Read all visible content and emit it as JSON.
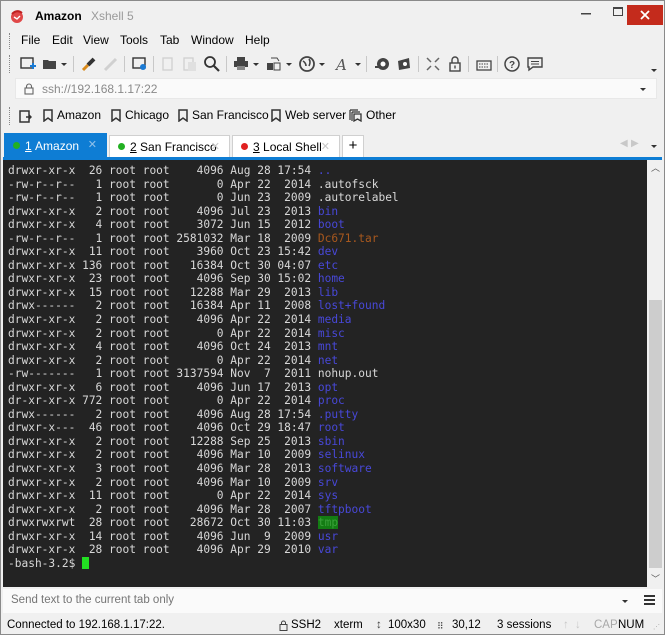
{
  "window": {
    "title": "Amazon",
    "app_name": "Xshell 5",
    "close_color": "#c42b1c"
  },
  "menu": [
    "File",
    "Edit",
    "View",
    "Tools",
    "Tab",
    "Window",
    "Help"
  ],
  "toolbar": {
    "icons": [
      "new-session-icon",
      "open-folder-icon",
      "connect-icon",
      "disconnect-icon",
      "session-properties-icon",
      "copy-icon",
      "paste-icon",
      "find-icon",
      "print-icon",
      "transfer-icon",
      "globe-icon",
      "font-icon",
      "xftp-icon",
      "xmanager-icon",
      "fullscreen-icon",
      "lock-icon",
      "keyboard-icon",
      "help-icon",
      "chat-icon"
    ]
  },
  "address": {
    "value": "ssh://192.168.1.17:22"
  },
  "links": [
    {
      "label": "Amazon"
    },
    {
      "label": "Chicago"
    },
    {
      "label": "San Francisco"
    },
    {
      "label": "Web server"
    },
    {
      "label": "Other"
    }
  ],
  "tabs": [
    {
      "num": "1",
      "label": "Amazon",
      "status_color": "#22b022",
      "active": true
    },
    {
      "num": "2",
      "label": "San Francisco",
      "status_color": "#22b022",
      "active": false
    },
    {
      "num": "3",
      "label": "Local Shell",
      "status_color": "#e02020",
      "active": false
    }
  ],
  "terminal": {
    "lines": [
      {
        "perm": "drwxr-xr-x",
        "links": "26",
        "owner": "root",
        "group": "root",
        "size": "4096",
        "date": "Aug 28 17:54",
        "name": "..",
        "type": "dir"
      },
      {
        "perm": "-rw-r--r--",
        "links": "1",
        "owner": "root",
        "group": "root",
        "size": "0",
        "date": "Apr 22  2014",
        "name": ".autofsck",
        "type": "file"
      },
      {
        "perm": "-rw-r--r--",
        "links": "1",
        "owner": "root",
        "group": "root",
        "size": "0",
        "date": "Jun 23  2009",
        "name": ".autorelabel",
        "type": "file"
      },
      {
        "perm": "drwxr-xr-x",
        "links": "2",
        "owner": "root",
        "group": "root",
        "size": "4096",
        "date": "Jul 23  2013",
        "name": "bin",
        "type": "dir"
      },
      {
        "perm": "drwxr-xr-x",
        "links": "4",
        "owner": "root",
        "group": "root",
        "size": "3072",
        "date": "Jun 15  2012",
        "name": "boot",
        "type": "dir"
      },
      {
        "perm": "-rw-r--r--",
        "links": "1",
        "owner": "root",
        "group": "root",
        "size": "2581032",
        "date": "Mar 18  2009",
        "name": "Dc671.tar",
        "type": "archive"
      },
      {
        "perm": "drwxr-xr-x",
        "links": "11",
        "owner": "root",
        "group": "root",
        "size": "3960",
        "date": "Oct 23 15:42",
        "name": "dev",
        "type": "dir"
      },
      {
        "perm": "drwxr-xr-x",
        "links": "136",
        "owner": "root",
        "group": "root",
        "size": "16384",
        "date": "Oct 30 04:07",
        "name": "etc",
        "type": "dir"
      },
      {
        "perm": "drwxr-xr-x",
        "links": "23",
        "owner": "root",
        "group": "root",
        "size": "4096",
        "date": "Sep 30 15:02",
        "name": "home",
        "type": "dir"
      },
      {
        "perm": "drwxr-xr-x",
        "links": "15",
        "owner": "root",
        "group": "root",
        "size": "12288",
        "date": "Mar 29  2013",
        "name": "lib",
        "type": "dir"
      },
      {
        "perm": "drwx------",
        "links": "2",
        "owner": "root",
        "group": "root",
        "size": "16384",
        "date": "Apr 11  2008",
        "name": "lost+found",
        "type": "dir"
      },
      {
        "perm": "drwxr-xr-x",
        "links": "2",
        "owner": "root",
        "group": "root",
        "size": "4096",
        "date": "Apr 22  2014",
        "name": "media",
        "type": "dir"
      },
      {
        "perm": "drwxr-xr-x",
        "links": "2",
        "owner": "root",
        "group": "root",
        "size": "0",
        "date": "Apr 22  2014",
        "name": "misc",
        "type": "dir"
      },
      {
        "perm": "drwxr-xr-x",
        "links": "4",
        "owner": "root",
        "group": "root",
        "size": "4096",
        "date": "Oct 24  2013",
        "name": "mnt",
        "type": "dir"
      },
      {
        "perm": "drwxr-xr-x",
        "links": "2",
        "owner": "root",
        "group": "root",
        "size": "0",
        "date": "Apr 22  2014",
        "name": "net",
        "type": "dir"
      },
      {
        "perm": "-rw-------",
        "links": "1",
        "owner": "root",
        "group": "root",
        "size": "3137594",
        "date": "Nov  7  2011",
        "name": "nohup.out",
        "type": "file"
      },
      {
        "perm": "drwxr-xr-x",
        "links": "6",
        "owner": "root",
        "group": "root",
        "size": "4096",
        "date": "Jun 17  2013",
        "name": "opt",
        "type": "dir"
      },
      {
        "perm": "dr-xr-xr-x",
        "links": "772",
        "owner": "root",
        "group": "root",
        "size": "0",
        "date": "Apr 22  2014",
        "name": "proc",
        "type": "dir"
      },
      {
        "perm": "drwx------",
        "links": "2",
        "owner": "root",
        "group": "root",
        "size": "4096",
        "date": "Aug 28 17:54",
        "name": ".putty",
        "type": "dir"
      },
      {
        "perm": "drwxr-x---",
        "links": "46",
        "owner": "root",
        "group": "root",
        "size": "4096",
        "date": "Oct 29 18:47",
        "name": "root",
        "type": "dir"
      },
      {
        "perm": "drwxr-xr-x",
        "links": "2",
        "owner": "root",
        "group": "root",
        "size": "12288",
        "date": "Sep 25  2013",
        "name": "sbin",
        "type": "dir"
      },
      {
        "perm": "drwxr-xr-x",
        "links": "2",
        "owner": "root",
        "group": "root",
        "size": "4096",
        "date": "Mar 10  2009",
        "name": "selinux",
        "type": "dir"
      },
      {
        "perm": "drwxr-xr-x",
        "links": "3",
        "owner": "root",
        "group": "root",
        "size": "4096",
        "date": "Mar 28  2013",
        "name": "software",
        "type": "dir"
      },
      {
        "perm": "drwxr-xr-x",
        "links": "2",
        "owner": "root",
        "group": "root",
        "size": "4096",
        "date": "Mar 10  2009",
        "name": "srv",
        "type": "dir"
      },
      {
        "perm": "drwxr-xr-x",
        "links": "11",
        "owner": "root",
        "group": "root",
        "size": "0",
        "date": "Apr 22  2014",
        "name": "sys",
        "type": "dir"
      },
      {
        "perm": "drwxr-xr-x",
        "links": "2",
        "owner": "root",
        "group": "root",
        "size": "4096",
        "date": "Mar 28  2007",
        "name": "tftpboot",
        "type": "dir"
      },
      {
        "perm": "drwxrwxrwt",
        "links": "28",
        "owner": "root",
        "group": "root",
        "size": "28672",
        "date": "Oct 30 11:03",
        "name": "tmp",
        "type": "sticky"
      },
      {
        "perm": "drwxr-xr-x",
        "links": "14",
        "owner": "root",
        "group": "root",
        "size": "4096",
        "date": "Jun  9  2009",
        "name": "usr",
        "type": "dir"
      },
      {
        "perm": "drwxr-xr-x",
        "links": "28",
        "owner": "root",
        "group": "root",
        "size": "4096",
        "date": "Apr 29  2010",
        "name": "var",
        "type": "dir"
      }
    ],
    "prompt": "-bash-3.2$ ",
    "colors": {
      "background": "#232323",
      "text": "#d8d8d8",
      "dir": "#4848d8",
      "archive": "#a8581e",
      "sticky_bg": "#137c13",
      "cursor": "#22e022"
    }
  },
  "send_bar": {
    "placeholder": "Send text to the current tab only"
  },
  "status": {
    "connection": "Connected to 192.168.1.17:22.",
    "protocol": "SSH2",
    "terminal_type": "xterm",
    "size": "100x30",
    "cursor_pos": "30,12",
    "sessions": "3 sessions",
    "cap": "CAP",
    "num": "NUM"
  }
}
